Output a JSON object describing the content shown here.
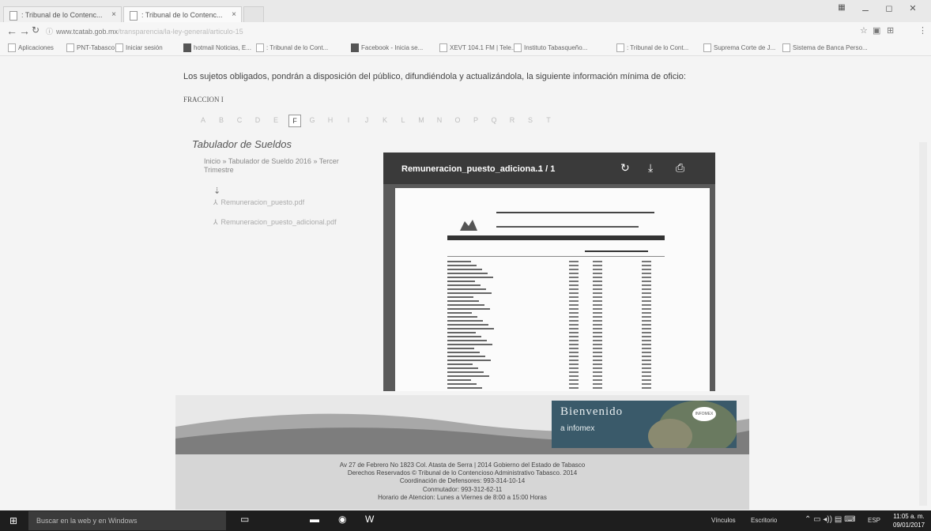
{
  "browser": {
    "tabs": [
      {
        "label": ": Tribunal de lo Contenc..."
      },
      {
        "label": ": Tribunal de lo Contenc..."
      }
    ],
    "tab_close": "×",
    "window_buttons": {
      "minimize": "–",
      "maximize": "◻",
      "close": "✕"
    },
    "url_host": "www.tcatab.gob.mx",
    "url_path": "/transparencia/la-ley-general/articulo-15",
    "bookmarks": [
      "Aplicaciones",
      "PNT-Tabasco",
      "Iniciar sesión",
      "hotmail Noticias, E...",
      ": Tribunal de lo Cont...",
      "Facebook - Inicia se...",
      "XEVT 104.1 FM | Tele...",
      "Instituto Tabasqueño...",
      ": Tribunal de lo Cont...",
      "Suprema Corte de J...",
      "Sistema de Banca Perso..."
    ]
  },
  "page": {
    "intro": "Los sujetos obligados, pondrán a disposición del público, difundiéndola y actualizándola, la siguiente información mínima de oficio:",
    "fraccion": "FRACCION I",
    "letters": [
      "A",
      "B",
      "C",
      "D",
      "E",
      "F",
      "G",
      "H",
      "I",
      "J",
      "K",
      "L",
      "M",
      "N",
      "O",
      "P",
      "Q",
      "R",
      "S",
      "T"
    ],
    "current_letter": "F",
    "section_title": "Tabulador de Sueldos",
    "breadcrumb": "Inicio » Tabulador de Sueldo 2016 » Tercer Trimestre",
    "links": [
      "Remuneracion_puesto.pdf",
      "Remuneracion_puesto_adicional.pdf"
    ]
  },
  "viewer": {
    "file_name": "Remuneracion_puesto_adiciona...",
    "pages": "1 / 1"
  },
  "banner": {
    "line1": "Bienvenido",
    "line2": "a infomex",
    "badge": "INFOMEX"
  },
  "footer": {
    "lines": [
      "Av 27 de Febrero No 1823 Col. Atasta de Serra | 2014 Gobierno del Estado de Tabasco",
      "Derechos Reservados © Tribunal de lo Contencioso Administrativo Tabasco. 2014",
      "Coordinación de Defensores: 993-314-10-14",
      "Conmutador: 993-312-62-11",
      "Horario de Atencion: Lunes a Viernes de 8:00 a 15:00 Horas"
    ]
  },
  "taskbar": {
    "search_placeholder": "Buscar en la web y en Windows",
    "tray_links": "Vínculos",
    "tray_desktop": "Escritorio",
    "lang": "ESP",
    "time": "11:05 a. m.",
    "date": "09/01/2017"
  }
}
